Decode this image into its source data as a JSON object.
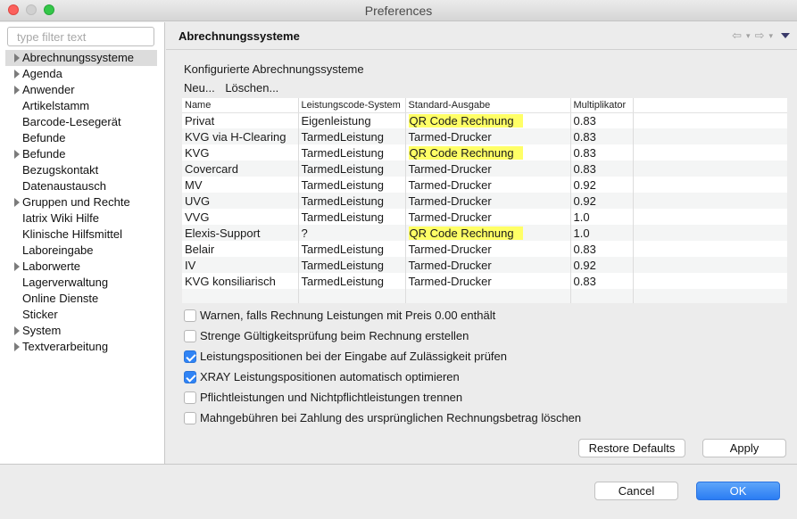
{
  "window": {
    "title": "Preferences"
  },
  "sidebar": {
    "filter_placeholder": "type filter text",
    "items": [
      {
        "label": "Abrechnungssysteme",
        "expandable": true,
        "selected": true
      },
      {
        "label": "Agenda",
        "expandable": true
      },
      {
        "label": "Anwender",
        "expandable": true
      },
      {
        "label": "Artikelstamm",
        "expandable": false
      },
      {
        "label": "Barcode-Lesegerät",
        "expandable": false
      },
      {
        "label": "Befunde",
        "expandable": false
      },
      {
        "label": "Befunde",
        "expandable": true
      },
      {
        "label": "Bezugskontakt",
        "expandable": false
      },
      {
        "label": "Datenaustausch",
        "expandable": false
      },
      {
        "label": "Gruppen und Rechte",
        "expandable": true
      },
      {
        "label": "Iatrix Wiki Hilfe",
        "expandable": false
      },
      {
        "label": "Klinische Hilfsmittel",
        "expandable": false
      },
      {
        "label": "Laboreingabe",
        "expandable": false
      },
      {
        "label": "Laborwerte",
        "expandable": true
      },
      {
        "label": "Lagerverwaltung",
        "expandable": false
      },
      {
        "label": "Online Dienste",
        "expandable": false
      },
      {
        "label": "Sticker",
        "expandable": false
      },
      {
        "label": "System",
        "expandable": true
      },
      {
        "label": "Textverarbeitung",
        "expandable": true
      }
    ]
  },
  "main": {
    "title": "Abrechnungssysteme",
    "nav": {
      "back_icon": "back-arrow-icon",
      "forward_icon": "forward-arrow-icon",
      "menu_icon": "view-menu-icon"
    },
    "group_label": "Konfigurierte Abrechnungssysteme",
    "actions": {
      "new_label": "Neu...",
      "delete_label": "Löschen..."
    },
    "table": {
      "headers": [
        "Name",
        "Leistungscode-System",
        "Standard-Ausgabe",
        "Multiplikator"
      ],
      "rows": [
        {
          "name": "Privat",
          "code": "Eigenleistung",
          "output": "QR Code Rechnung",
          "mult": "0.83",
          "highlight": true
        },
        {
          "name": "KVG via H-Clearing",
          "code": "TarmedLeistung",
          "output": "Tarmed-Drucker",
          "mult": "0.83",
          "highlight": false
        },
        {
          "name": "KVG",
          "code": "TarmedLeistung",
          "output": "QR Code Rechnung",
          "mult": "0.83",
          "highlight": true
        },
        {
          "name": "Covercard",
          "code": "TarmedLeistung",
          "output": "Tarmed-Drucker",
          "mult": "0.83",
          "highlight": false
        },
        {
          "name": "MV",
          "code": "TarmedLeistung",
          "output": "Tarmed-Drucker",
          "mult": "0.92",
          "highlight": false
        },
        {
          "name": "UVG",
          "code": "TarmedLeistung",
          "output": "Tarmed-Drucker",
          "mult": "0.92",
          "highlight": false
        },
        {
          "name": "VVG",
          "code": "TarmedLeistung",
          "output": "Tarmed-Drucker",
          "mult": "1.0",
          "highlight": false
        },
        {
          "name": "Elexis-Support",
          "code": "?",
          "output": "QR Code Rechnung",
          "mult": "1.0",
          "highlight": true
        },
        {
          "name": "Belair",
          "code": "TarmedLeistung",
          "output": "Tarmed-Drucker",
          "mult": "0.83",
          "highlight": false
        },
        {
          "name": "IV",
          "code": "TarmedLeistung",
          "output": "Tarmed-Drucker",
          "mult": "0.92",
          "highlight": false
        },
        {
          "name": "KVG konsiliarisch",
          "code": "TarmedLeistung",
          "output": "Tarmed-Drucker",
          "mult": "0.83",
          "highlight": false
        }
      ]
    },
    "options": [
      {
        "label": "Warnen, falls Rechnung Leistungen mit Preis 0.00 enthält",
        "checked": false
      },
      {
        "label": "Strenge Gültigkeitsprüfung beim Rechnung erstellen",
        "checked": false
      },
      {
        "label": "Leistungspositionen bei der Eingabe auf Zulässigkeit prüfen",
        "checked": true
      },
      {
        "label": "XRAY Leistungspositionen automatisch optimieren",
        "checked": true
      },
      {
        "label": "Pflichtleistungen und Nichtpflichtleistungen trennen",
        "checked": false
      },
      {
        "label": "Mahngebühren bei Zahlung des ursprünglichen Rechnungsbetrag löschen",
        "checked": false
      }
    ],
    "restore_label": "Restore Defaults",
    "apply_label": "Apply"
  },
  "footer": {
    "cancel_label": "Cancel",
    "ok_label": "OK"
  },
  "colors": {
    "highlight": "#ffff66",
    "accent": "#2f83f5",
    "selection": "#dcdcdc"
  }
}
